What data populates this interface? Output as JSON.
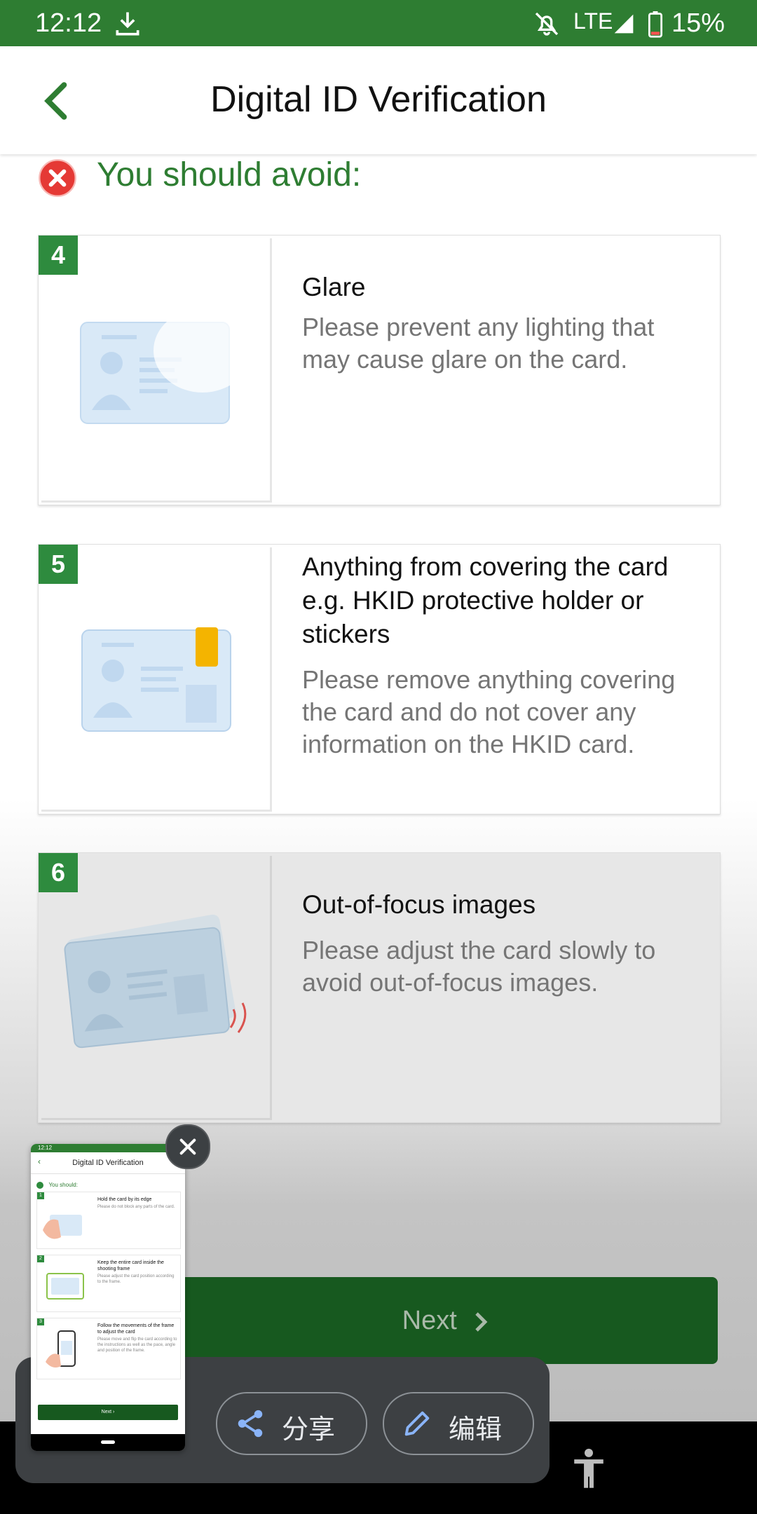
{
  "status_bar": {
    "time": "12:12",
    "network": "LTE",
    "battery": "15%",
    "icons": [
      "download-icon",
      "mute-icon",
      "signal-icon",
      "battery-icon"
    ]
  },
  "app_bar": {
    "title": "Digital ID Verification",
    "back_icon": "chevron-left-icon"
  },
  "avoid_section": {
    "heading": "You should avoid:",
    "items": [
      {
        "number": "4",
        "title": "Glare",
        "description": "Please prevent any lighting that may cause glare on the card."
      },
      {
        "number": "5",
        "title": "Anything from covering the card e.g. HKID protective holder or stickers",
        "description": "Please remove anything covering the card and do not cover any information on the HKID card."
      },
      {
        "number": "6",
        "title": "Out-of-focus images",
        "description": "Please adjust the card slowly to avoid out-of-focus images."
      }
    ]
  },
  "next_button": {
    "label": "Next"
  },
  "screenshot_toast": {
    "share_label": "分享",
    "edit_label": "编辑",
    "thumbnail": {
      "time": "12:12",
      "title": "Digital ID Verification",
      "heading": "You should:",
      "items": [
        {
          "number": "1",
          "title": "Hold the card by its edge",
          "description": "Please do not block any parts of the card."
        },
        {
          "number": "2",
          "title": "Keep the entire card inside the shooting frame",
          "description": "Please adjust the card position according to the frame."
        },
        {
          "number": "3",
          "title": "Follow the movements of the frame to adjust the card",
          "description": "Please move and flip the card according to the instructions as well as the pace, angle and position of the frame."
        }
      ],
      "next_label": "Next"
    }
  },
  "colors": {
    "brand_green": "#2e7d32",
    "badge_green": "#2e8b3e",
    "button_green": "#17591f",
    "error_red": "#e53935"
  }
}
